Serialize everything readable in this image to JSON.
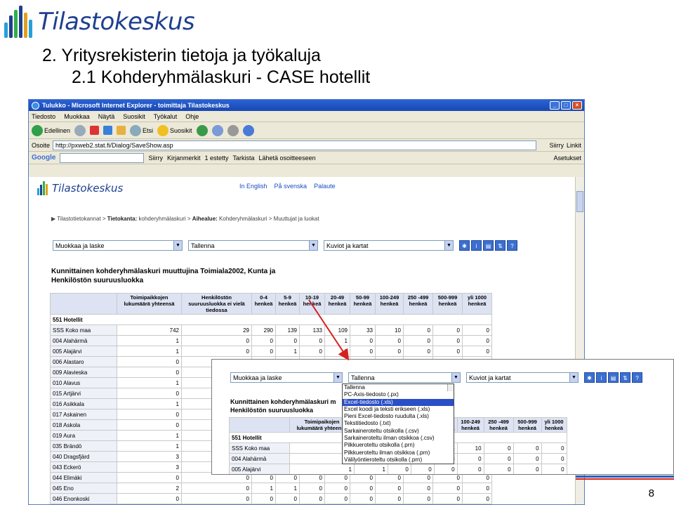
{
  "slide": {
    "logo_text": "Tilastokeskus",
    "title_line1": "2. Yritysrekisterin tietoja ja työkaluja",
    "title_line2": "2.1 Kohderyhmälaskuri - CASE hotellit",
    "page_number": "8"
  },
  "browser": {
    "window_title": "Tulukko - Microsoft Internet Explorer - toimittaja Tilastokeskus",
    "menu": [
      "Tiedosto",
      "Muokkaa",
      "Näytä",
      "Suosikit",
      "Työkalut",
      "Ohje"
    ],
    "toolbar": {
      "back": "Edellinen",
      "search": "Etsi",
      "favorites": "Suosikit"
    },
    "address_label": "Osoite",
    "address_value": "http://pxweb2.stat.fi/Dialog/SaveShow.asp",
    "go_label": "Siirry",
    "links_label": "Linkit",
    "google_bar": {
      "logo": "Google",
      "go": "Siirry",
      "bookmarks": "Kirjanmerkit",
      "blocked": "1 estetty",
      "check": "Tarkista",
      "send": "Lähetä osoitteeseen",
      "settings": "Asetukset"
    }
  },
  "site": {
    "logo_text": "Tilastokeskus",
    "links": [
      "In English",
      "På svenska",
      "Palaute"
    ],
    "breadcrumb": {
      "part1": "Tilastotietokannat",
      "part2_label": "Tietokanta:",
      "part2_value": "kohderyhmälaskuri",
      "part3_label": "Aihealue:",
      "part3_value": "Kohderyhmälaskuri",
      "part4": "Muuttujat ja luokat"
    },
    "selects": {
      "edit": "Muokkaa ja laske",
      "save": "Tallenna",
      "charts": "Kuviot ja kartat"
    },
    "tool_icons": [
      "info",
      "i",
      "print",
      "sort",
      "help"
    ],
    "report_title_line1": "Kunnittainen kohderyhmälaskuri muuttujina Toimiala2002, Kunta ja",
    "report_title_line2": "Henkilöstön suuruusluokka",
    "table": {
      "headers": [
        "",
        "Toimipaikkojen lukumäärä yhteensä",
        "Henkilöstön suuruusluokka ei vielä tiedossa",
        "0-4 henkeä",
        "5-9 henkeä",
        "10-19 henkeä",
        "20-49 henkeä",
        "50-99 henkeä",
        "100-249 henkeä",
        "250 -499 henkeä",
        "500-999 henkeä",
        "yli 1000 henkeä"
      ],
      "group": "551 Hotellit",
      "rows": [
        [
          "SSS Koko maa",
          "742",
          "29",
          "290",
          "139",
          "133",
          "109",
          "33",
          "10",
          "0",
          "0",
          "0"
        ],
        [
          "004 Alahärmä",
          "1",
          "0",
          "0",
          "0",
          "0",
          "1",
          "0",
          "0",
          "0",
          "0",
          "0"
        ],
        [
          "005 Alajärvi",
          "1",
          "0",
          "0",
          "1",
          "0",
          "0",
          "0",
          "0",
          "0",
          "0",
          "0"
        ],
        [
          "006 Alastaro",
          "0",
          "",
          "",
          "",
          "",
          "",
          "",
          "",
          "",
          "",
          ""
        ],
        [
          "009 Alavieska",
          "0",
          "",
          "",
          "",
          "",
          "",
          "",
          "",
          "",
          "",
          ""
        ],
        [
          "010 Alavus",
          "1",
          "",
          "",
          "",
          "",
          "",
          "",
          "",
          "",
          "",
          ""
        ],
        [
          "015 Artjärvi",
          "0",
          "",
          "",
          "",
          "",
          "",
          "",
          "",
          "",
          "",
          ""
        ],
        [
          "016 Asikkala",
          "1",
          "",
          "",
          "",
          "",
          "",
          "",
          "",
          "",
          "",
          ""
        ],
        [
          "017 Askainen",
          "0",
          "",
          "",
          "",
          "",
          "",
          "",
          "",
          "",
          "",
          ""
        ],
        [
          "018 Askola",
          "0",
          "",
          "",
          "",
          "",
          "",
          "",
          "",
          "",
          "",
          ""
        ],
        [
          "019 Aura",
          "1",
          "",
          "",
          "",
          "",
          "",
          "",
          "",
          "",
          "",
          ""
        ],
        [
          "035 Brändö",
          "1",
          "",
          "",
          "",
          "",
          "",
          "",
          "",
          "",
          "",
          ""
        ],
        [
          "040 Dragsfjärd",
          "3",
          "",
          "",
          "",
          "",
          "",
          "",
          "",
          "",
          "",
          ""
        ],
        [
          "043 Eckerö",
          "3",
          "",
          "",
          "",
          "",
          "",
          "",
          "",
          "",
          "",
          ""
        ],
        [
          "044 Elimäki",
          "0",
          "0",
          "0",
          "0",
          "0",
          "0",
          "0",
          "0",
          "0",
          "0",
          "0"
        ],
        [
          "045 Eno",
          "2",
          "0",
          "1",
          "1",
          "0",
          "0",
          "0",
          "0",
          "0",
          "0",
          "0"
        ],
        [
          "046 Enonkoski",
          "0",
          "0",
          "0",
          "0",
          "0",
          "0",
          "0",
          "0",
          "0",
          "0",
          "0"
        ]
      ]
    }
  },
  "zoom": {
    "selects": {
      "edit": "Muokkaa ja laske",
      "save": "Tallenna",
      "charts": "Kuviot ja kartat"
    },
    "report_title_line1": "Kunnittainen kohderyhmälaskuri m",
    "report_title_line2": "Henkilöstön suuruusluokka",
    "dropdown": [
      "Tallenna",
      "PC-Axis-tiedosto (.px)",
      "Excel-tiedosto (.xls)",
      "Excel koodi ja teksti erikseen (.xls)",
      "Pieni Excel-tiedosto ruudulta (.xls)",
      "Tekstitiedosto (.txt)",
      "Sarkaineroteltu otsikolla (.csv)",
      "Sarkaineroteltu ilman otsikkoa (.csv)",
      "Pilkkueroteltu otsikolla (.prn)",
      "Pilkkueroteltu ilman otsikkoa (.prn)",
      "Välilyöntieroteltu otsikolla (.prn)"
    ],
    "dropdown_selected_index": 2,
    "table": {
      "headers": [
        "",
        "Toimipaikojen lukumäärä yhteensä",
        "",
        "10-19 henkeä",
        "20-49 henkeä",
        "50-99 henkeä",
        "100-249 henkeä",
        "250 -499 henkeä",
        "500-999 henkeä",
        "yli 1000 henkeä"
      ],
      "group": "551 Hotellit",
      "rows": [
        [
          "SSS Koko maa",
          "74",
          "39",
          "133",
          "109",
          "33",
          "10",
          "0",
          "0",
          "0"
        ],
        [
          "004 Alahärmä",
          "1",
          "0",
          "0",
          "1",
          "0",
          "0",
          "0",
          "0",
          "0"
        ],
        [
          "005 Alajärvi",
          "1",
          "1",
          "0",
          "0",
          "0",
          "0",
          "0",
          "0",
          "0"
        ]
      ]
    }
  },
  "colors": {
    "brand_blue": "#1f3f8f",
    "title_bar": "#2a62d6",
    "selected": "#2a4fc6",
    "arrow": "#d62020"
  }
}
